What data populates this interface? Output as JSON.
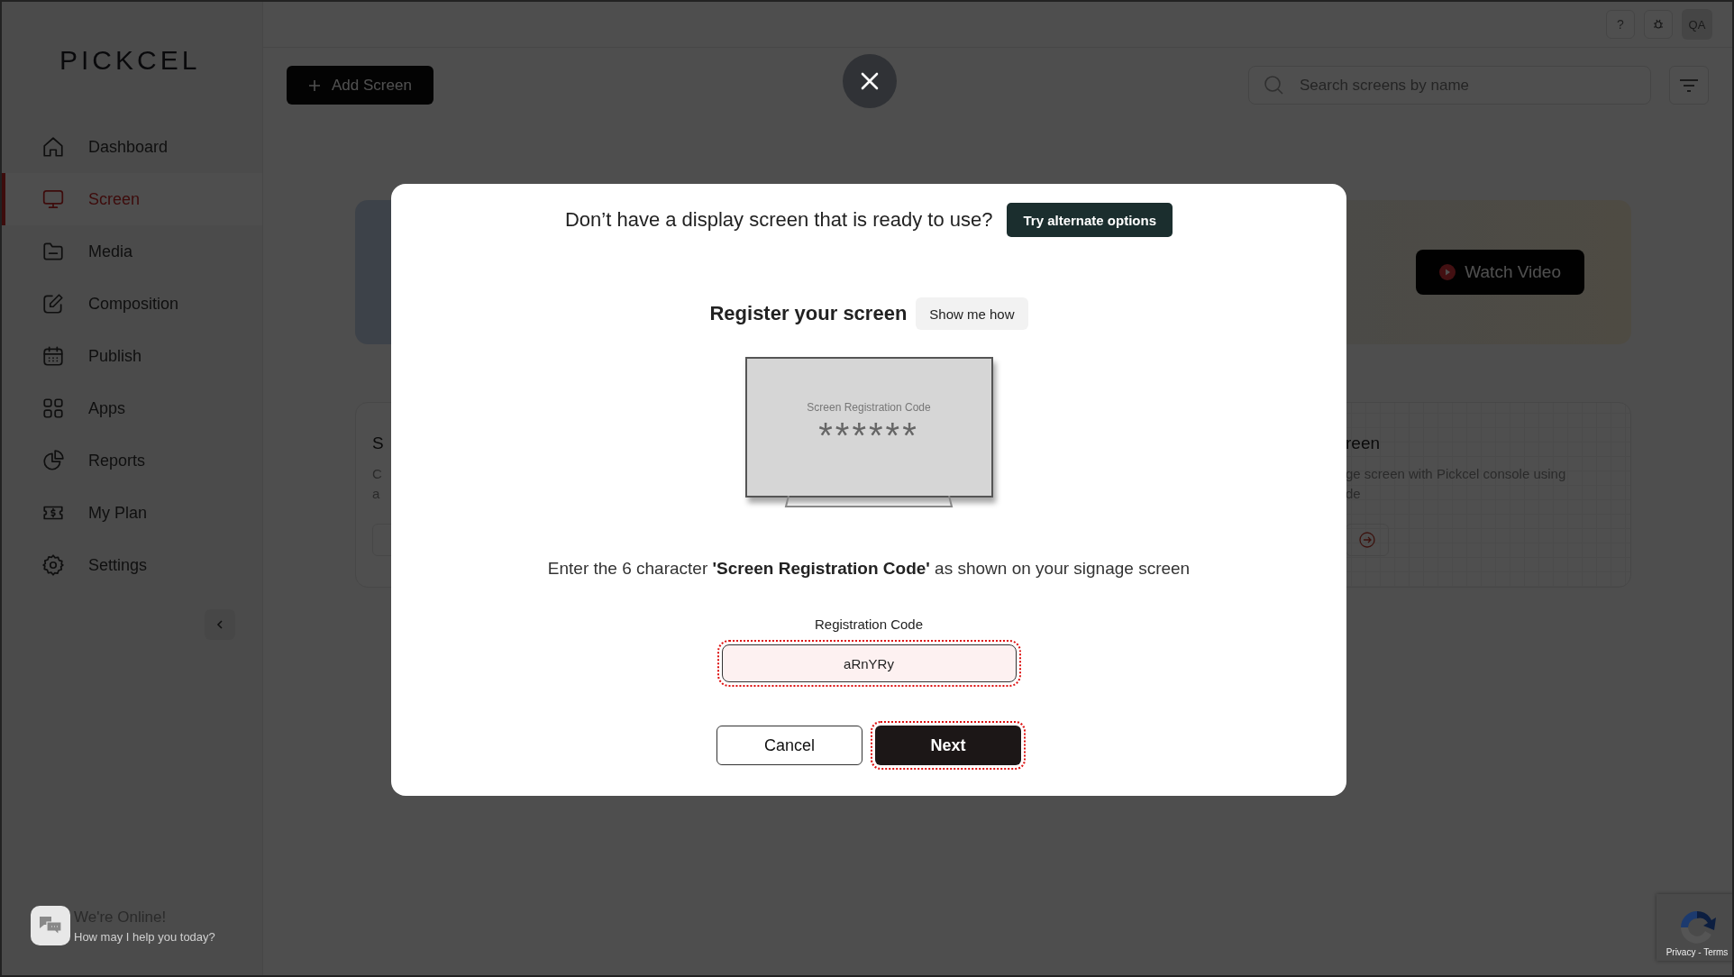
{
  "sidebar": {
    "logo": "PICKCEL",
    "items": [
      {
        "label": "Dashboard",
        "selected": false
      },
      {
        "label": "Screen",
        "selected": true
      },
      {
        "label": "Media",
        "selected": false
      },
      {
        "label": "Composition",
        "selected": false
      },
      {
        "label": "Publish",
        "selected": false
      },
      {
        "label": "Apps",
        "selected": false
      },
      {
        "label": "Reports",
        "selected": false
      },
      {
        "label": "My Plan",
        "selected": false
      },
      {
        "label": "Settings",
        "selected": false
      }
    ]
  },
  "topbar": {
    "help": "?",
    "avatar": "QA"
  },
  "toolbar": {
    "add_button": "Add Screen",
    "search": {
      "placeholder": "Search screens by name"
    }
  },
  "banner": {
    "watch_button": "Watch Video"
  },
  "cards": [
    {
      "title": "S",
      "description": [
        "C",
        "a"
      ]
    },
    {
      "title": "reen",
      "description": [
        "ge screen with Pickcel console using",
        "de"
      ]
    }
  ],
  "modal": {
    "prompt": "Don’t have a display screen that is ready to use?",
    "alt_button": "Try alternate options",
    "heading": "Register your screen",
    "help_button": "Show me how",
    "tv": {
      "caption": "Screen Registration Code",
      "code_mask": "******"
    },
    "instruction": "Enter the 6 character **'Screen Registration Code'** as shown on your signage screen",
    "field": {
      "label": "Registration Code",
      "value": "aRnYRy",
      "highlighted": true
    },
    "buttons": [
      {
        "label": "Cancel",
        "kind": "secondary",
        "highlighted": false
      },
      {
        "label": "Next",
        "kind": "primary",
        "highlighted": true
      }
    ]
  },
  "chat": {
    "title": "We're Online!",
    "subtitle": "How may I help you today?"
  },
  "recaptcha": {
    "links": "Privacy - Terms"
  }
}
